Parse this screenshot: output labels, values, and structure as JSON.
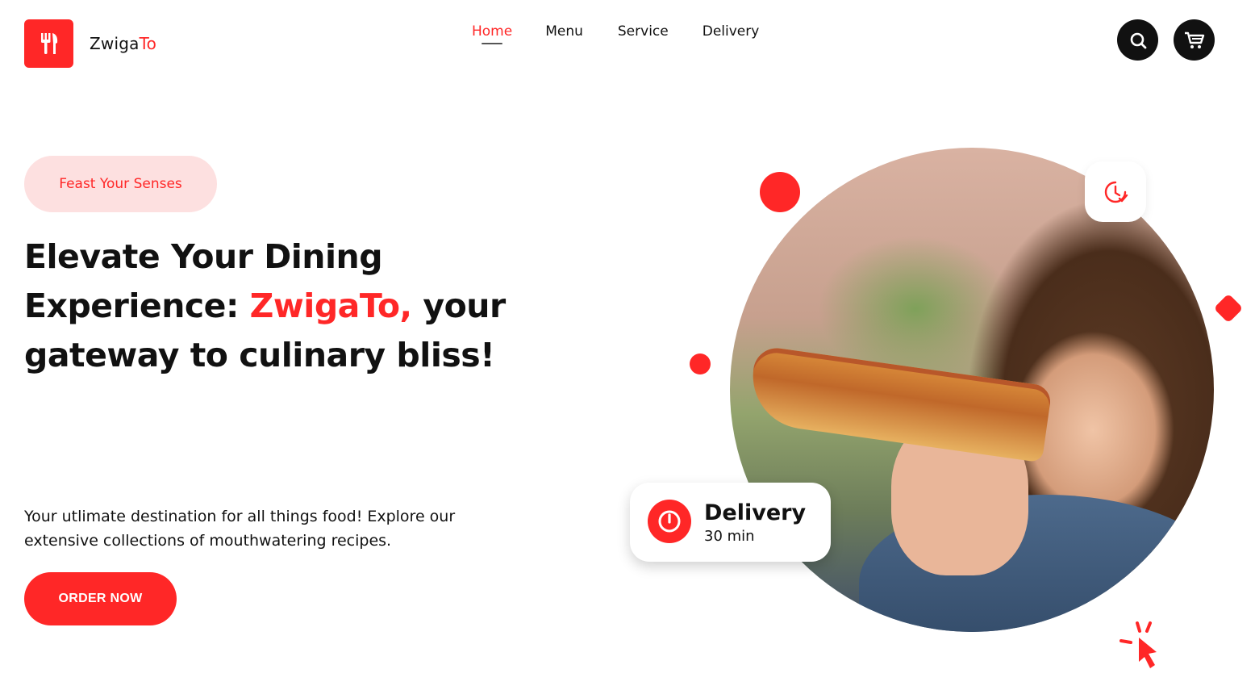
{
  "brand": {
    "name_main": "Zwiga",
    "name_accent": "To",
    "accent_color": "#ff2727"
  },
  "nav": [
    {
      "label": "Home",
      "active": true
    },
    {
      "label": "Menu",
      "active": false
    },
    {
      "label": "Service",
      "active": false
    },
    {
      "label": "Delivery",
      "active": false
    }
  ],
  "header_actions": {
    "search_icon": "search-icon",
    "cart_icon": "cart-icon"
  },
  "hero": {
    "tag": "Feast Your Senses",
    "headline_pre": "Elevate Your Dining Experience: ",
    "headline_highlight": "ZwigaTo,",
    "headline_post": " your gateway to culinary bliss!",
    "description": "Your utlimate  destination for all things food! Explore our extensive collections of mouthwatering recipes.",
    "cta_label": "ORDER NOW"
  },
  "delivery_card": {
    "title": "Delivery",
    "subtitle": "30 min",
    "icon": "power-timer-icon"
  },
  "decor_icons": {
    "clock": "clock-icon",
    "cursor": "click-cursor-icon"
  },
  "colors": {
    "accent": "#ff2727",
    "pill_bg": "#fde0e0",
    "dark": "#111111"
  }
}
